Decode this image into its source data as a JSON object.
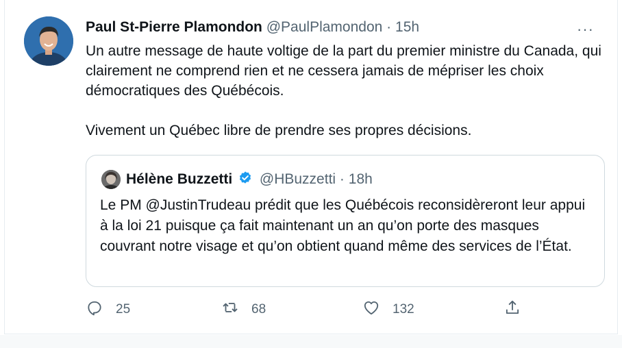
{
  "tweet": {
    "author": "Paul St-Pierre Plamondon",
    "handle": "@PaulPlamondon",
    "separator": "·",
    "time": "15h",
    "text_p1": "Un autre message de haute voltige de la part du premier ministre du Canada, qui clairement ne comprend rien et ne cessera jamais de mépriser les choix démocratiques des Québécois.",
    "text_p2": "Vivement un Québec libre de prendre ses propres décisions.",
    "more_label": "···"
  },
  "quoted": {
    "author": "Hélène Buzzetti",
    "handle": "@HBuzzetti",
    "separator": "·",
    "time": "18h",
    "text": "Le PM @JustinTrudeau prédit que les Québécois reconsidèreront leur appui à la loi 21 puisque ça fait maintenant un an qu’on porte des masques couvrant notre visage et qu’on obtient quand même des services de l’État."
  },
  "actions": {
    "replies": "25",
    "retweets": "68",
    "likes": "132"
  },
  "colors": {
    "text": "#0f1419",
    "muted": "#536471",
    "verified": "#1d9bf0",
    "border": "#cfd9de"
  },
  "icons": [
    "reply-icon",
    "retweet-icon",
    "like-icon",
    "share-icon",
    "verified-badge-icon",
    "more-icon"
  ]
}
